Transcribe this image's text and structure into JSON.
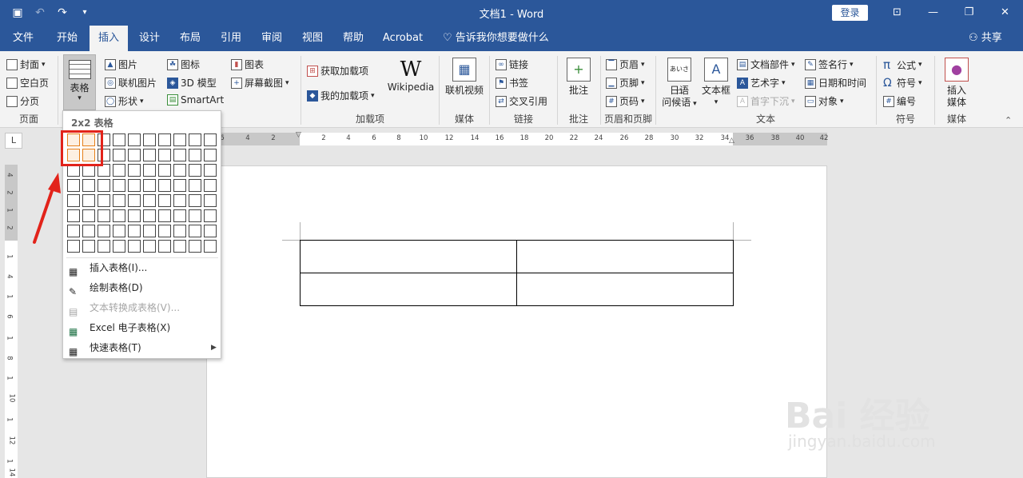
{
  "title_bar": {
    "doc_title": "文档1  -  Word",
    "login": "登录"
  },
  "tabs": [
    {
      "label": "文件"
    },
    {
      "label": "开始"
    },
    {
      "label": "插入",
      "active": true
    },
    {
      "label": "设计"
    },
    {
      "label": "布局"
    },
    {
      "label": "引用"
    },
    {
      "label": "审阅"
    },
    {
      "label": "视图"
    },
    {
      "label": "帮助"
    },
    {
      "label": "Acrobat"
    }
  ],
  "tell_me": "告诉我你想要做什么",
  "share": "共享",
  "ribbon": {
    "pages": {
      "cover": "封面",
      "blank": "空白页",
      "break": "分页",
      "group": "页面"
    },
    "table": {
      "label": "表格"
    },
    "illustrations": {
      "picture": "图片",
      "online_picture": "联机图片",
      "shapes": "形状",
      "icons": "图标",
      "model3d": "3D 模型",
      "smartart": "SmartArt",
      "chart": "图表",
      "screenshot": "屏幕截图"
    },
    "addins": {
      "get": "获取加载项",
      "mine": "我的加载项",
      "wikipedia": "Wikipedia",
      "group": "加载项"
    },
    "media": {
      "online_video": "联机视频",
      "group": "媒体"
    },
    "links": {
      "link": "链接",
      "bookmark": "书签",
      "crossref": "交叉引用",
      "group": "链接"
    },
    "comments": {
      "comment": "批注",
      "group": "批注"
    },
    "header_footer": {
      "header": "页眉",
      "footer": "页脚",
      "page_number": "页码",
      "group": "页眉和页脚"
    },
    "text": {
      "greeting_line1": "日语",
      "greeting_line2": "问候语",
      "textbox": "文本框",
      "quickparts": "文档部件",
      "wordart": "艺术字",
      "dropcap": "首字下沉",
      "signature": "签名行",
      "datetime": "日期和时间",
      "object": "对象",
      "group": "文本"
    },
    "symbols": {
      "equation": "公式",
      "symbol": "符号",
      "numbering": "编号",
      "group": "符号"
    },
    "media2": {
      "insert_line1": "插入",
      "insert_line2": "媒体",
      "group": "媒体"
    }
  },
  "dropdown": {
    "header": "2x2 表格",
    "grid_rows": 8,
    "grid_cols": 10,
    "selected_rows": 2,
    "selected_cols": 2,
    "items": [
      {
        "label": "插入表格(I)...",
        "enabled": true
      },
      {
        "label": "绘制表格(D)",
        "enabled": true
      },
      {
        "label": "文本转换成表格(V)...",
        "enabled": false
      },
      {
        "label": "Excel 电子表格(X)",
        "enabled": true
      },
      {
        "label": "快速表格(T)",
        "enabled": true,
        "submenu": true
      }
    ]
  },
  "hruler_ticks": [
    "6",
    "4",
    "2",
    "2",
    "4",
    "6",
    "8",
    "10",
    "12",
    "14",
    "16",
    "18",
    "20",
    "22",
    "24",
    "26",
    "28",
    "30",
    "32",
    "34",
    "36",
    "38",
    "40",
    "42"
  ],
  "vruler_ticks": [
    "4",
    "2",
    "1",
    "2",
    "1",
    "4",
    "1",
    "6",
    "1",
    "8",
    "1",
    "10",
    "1",
    "12",
    "1",
    "14"
  ],
  "document_table": {
    "rows": 2,
    "cols": 2
  },
  "watermark": {
    "logo": "Bai 经验",
    "url": "jingyan.baidu.com"
  },
  "ruler_tab": "L"
}
